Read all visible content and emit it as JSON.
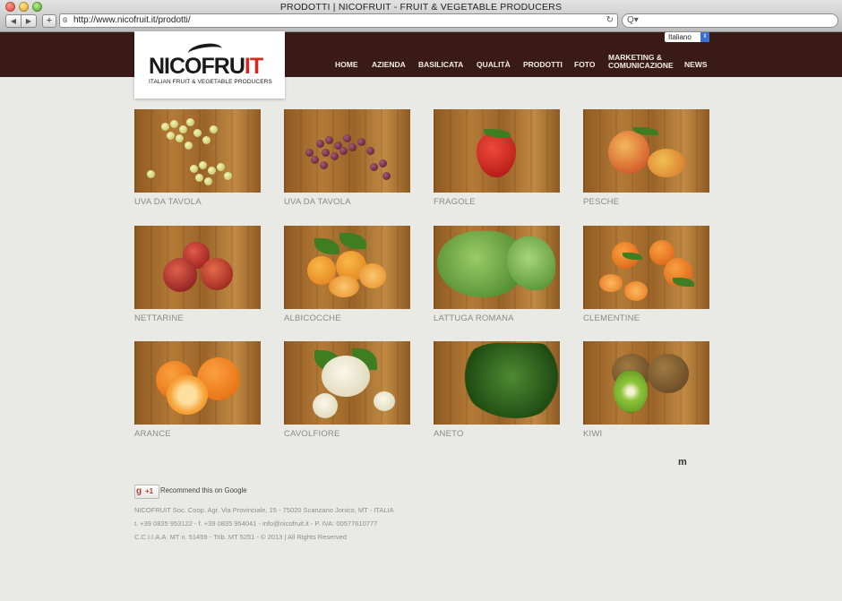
{
  "window": {
    "title": "PRODOTTI | NICOFRUIT - FRUIT & VEGETABLE PRODUCERS"
  },
  "toolbar": {
    "back": "◀",
    "forward": "▶",
    "add": "+",
    "reload": "↻"
  },
  "address": {
    "url": "http://www.nicofruit.it/prodotti/"
  },
  "search": {
    "icon": "Q▾",
    "value": ""
  },
  "logo": {
    "name_prefix": "NICOFRU",
    "name_highlight": "IT",
    "tagline": "ITALIAN FRUIT & VEGETABLE PRODUCERS"
  },
  "language": {
    "selected": "Italiano"
  },
  "menu": {
    "items": [
      {
        "label": "HOME"
      },
      {
        "label": "AZIENDA"
      },
      {
        "label": "BASILICATA"
      },
      {
        "label": "QUALITÀ"
      },
      {
        "label": "PRODOTTI"
      },
      {
        "label": "FOTO"
      },
      {
        "label": "MARKETING &"
      },
      {
        "label": "COMUNICAZIONE"
      },
      {
        "label": "NEWS"
      }
    ]
  },
  "products": [
    {
      "name": "UVA DA TAVOLA",
      "color": "#cfd27a"
    },
    {
      "name": "UVA DA TAVOLA",
      "color": "#6a2438"
    },
    {
      "name": "FRAGOLE",
      "color": "#c41a1a"
    },
    {
      "name": "PESCHE",
      "color": "#e88a2a"
    },
    {
      "name": "NETTARINE",
      "color": "#a82428"
    },
    {
      "name": "ALBICOCCHE",
      "color": "#ef9a2a"
    },
    {
      "name": "LATTUGA ROMANA",
      "color": "#5f9d3a"
    },
    {
      "name": "CLEMENTINE",
      "color": "#ee7a14"
    },
    {
      "name": "ARANCE",
      "color": "#f07c10"
    },
    {
      "name": "CAVOLFIORE",
      "color": "#ece6cc"
    },
    {
      "name": "ANETO",
      "color": "#2f6a1e"
    },
    {
      "name": "KIWI",
      "color": "#8b6a3a"
    }
  ],
  "social": {
    "gplus_label": "+1",
    "gplus_icon": "g",
    "recommend": "Recommend this on Google"
  },
  "footer": {
    "line1": "NICOFRUIT Soc. Coop. Agr. Via Provinciale, 15 - 75020 Scanzano Jonico, MT - ITALIA",
    "line2": "t. +39 0835 953122 - f. +39 0835 954041 - info@nicofruit.it - P. IVA: 00577610777",
    "line3": "C.C.I.I.A.A. MT n. 51459 - Trib. MT 5251 - © 2013 | All Rights Reserved"
  },
  "credit": {
    "mark": "m"
  }
}
